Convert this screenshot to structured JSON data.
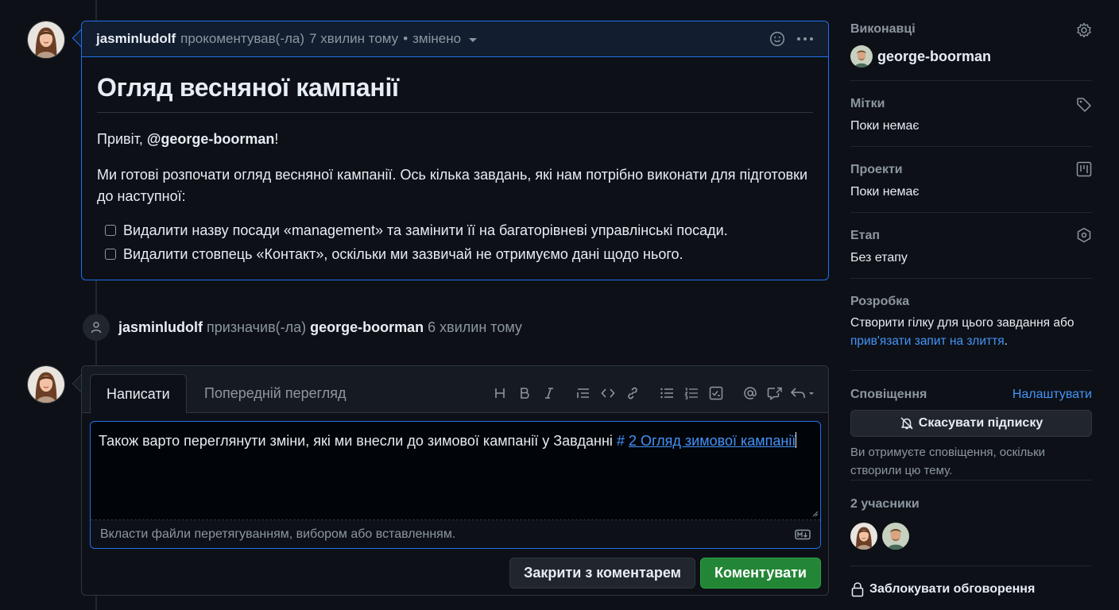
{
  "comment": {
    "author": "jasminludolf",
    "action": "прокоментував(-ла)",
    "time": "7 хвилин тому",
    "separator": "•",
    "edited": "змінено",
    "title": "Огляд весняної кампанії",
    "greeting_prefix": "Привіт, ",
    "greeting_mention": "@george-boorman",
    "greeting_suffix": "!",
    "paragraph": "Ми готові розпочати огляд весняної кампанії. Ось кілька завдань, які нам потрібно виконати для підготовки до наступної:",
    "tasks": [
      "Видалити назву посади «management» та замінити її на багаторівневі управлінські посади.",
      "Видалити стовпець «Контакт», оскільки ми зазвичай не отримуємо дані щодо нього."
    ]
  },
  "event": {
    "actor": "jasminludolf",
    "action": "призначив(-ла)",
    "target": "george-boorman",
    "time": "6 хвилин тому"
  },
  "editor": {
    "tab_write": "Написати",
    "tab_preview": "Попередній перегляд",
    "text": "Також варто переглянути зміни, які ми внесли до зимової кампанії у Завданні ",
    "issue_hash": "#",
    "issue_title": "2 Огляд зимової кампанії",
    "attach_hint": "Вкласти файли перетягуванням, вибором або вставленням.",
    "close_button": "Закрити з коментарем",
    "comment_button": "Коментувати"
  },
  "sidebar": {
    "assignees_label": "Виконавці",
    "assignee": "george-boorman",
    "labels_label": "Мітки",
    "labels_value": "Поки немає",
    "projects_label": "Проекти",
    "projects_value": "Поки немає",
    "milestone_label": "Етап",
    "milestone_value": "Без етапу",
    "development_label": "Розробка",
    "development_text": "Створити гілку для цього завдання або",
    "development_link": "прив'язати запит на злиття",
    "development_end": ".",
    "notifications_label": "Сповіщення",
    "notifications_customize": "Налаштувати",
    "unsubscribe": "Скасувати підписку",
    "notification_note": "Ви отримуєте сповіщення, оскільки створили цю тему.",
    "participants_label": "2 учасники",
    "lock": "Заблокувати обговорення"
  },
  "colors": {
    "background": "#0d1117",
    "accent_blue": "#1f6feb",
    "link_blue": "#4493f8",
    "primary_green": "#238636"
  }
}
